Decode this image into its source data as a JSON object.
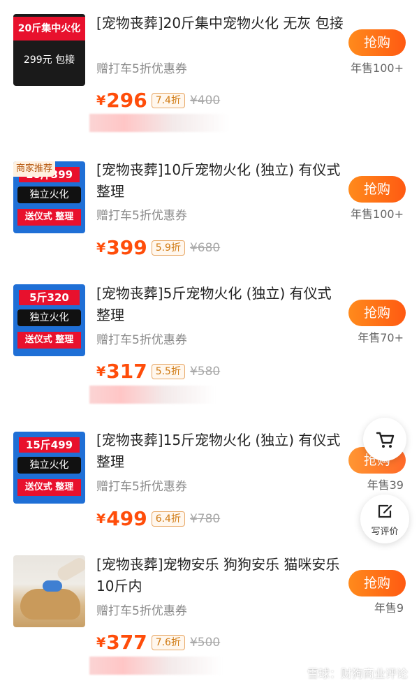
{
  "products": [
    {
      "title": "[宠物丧葬]20斤集中宠物火化 无灰 包接",
      "coupon": "赠打车5折优惠券",
      "yen": "¥",
      "price": "296",
      "discount": "7.4折",
      "original": "¥400",
      "buy": "抢购",
      "sold": "年售100+",
      "thumb": {
        "band": "20斤集中火化",
        "sub": "299元 包接"
      }
    },
    {
      "title": "[宠物丧葬]10斤宠物火化 (独立) 有仪式 整理",
      "coupon": "赠打车5折优惠券",
      "yen": "¥",
      "price": "399",
      "discount": "5.9折",
      "original": "¥680",
      "buy": "抢购",
      "sold": "年售100+",
      "thumb": {
        "ad": "商家推荐",
        "top": "10斤399",
        "mid": "独立火化",
        "bot": "送仪式 整理"
      }
    },
    {
      "title": "[宠物丧葬]5斤宠物火化 (独立) 有仪式 整理",
      "coupon": "赠打车5折优惠券",
      "yen": "¥",
      "price": "317",
      "discount": "5.5折",
      "original": "¥580",
      "buy": "抢购",
      "sold": "年售70+",
      "thumb": {
        "top": "5斤320",
        "mid": "独立火化",
        "bot": "送仪式 整理"
      }
    },
    {
      "title": "[宠物丧葬]15斤宠物火化 (独立) 有仪式 整理",
      "coupon": "赠打车5折优惠券",
      "yen": "¥",
      "price": "499",
      "discount": "6.4折",
      "original": "¥780",
      "buy": "抢购",
      "sold": "年售39",
      "thumb": {
        "top": "15斤499",
        "mid": "独立火化",
        "bot": "送仪式 整理"
      }
    },
    {
      "title": "[宠物丧葬]宠物安乐 狗狗安乐 猫咪安乐 10斤内",
      "coupon": "赠打车5折优惠券",
      "yen": "¥",
      "price": "377",
      "discount": "7.6折",
      "original": "¥500",
      "buy": "抢购",
      "sold": "年售9"
    }
  ],
  "floating": {
    "cart_icon": "cart-icon",
    "review_icon": "edit-review-icon",
    "review_label": "写评价"
  },
  "watermark": {
    "text": "雪球：财狗商业评论"
  },
  "colors": {
    "accent": "#ff5a12",
    "price": "#ff4d0a",
    "badge": "#d07a12"
  }
}
